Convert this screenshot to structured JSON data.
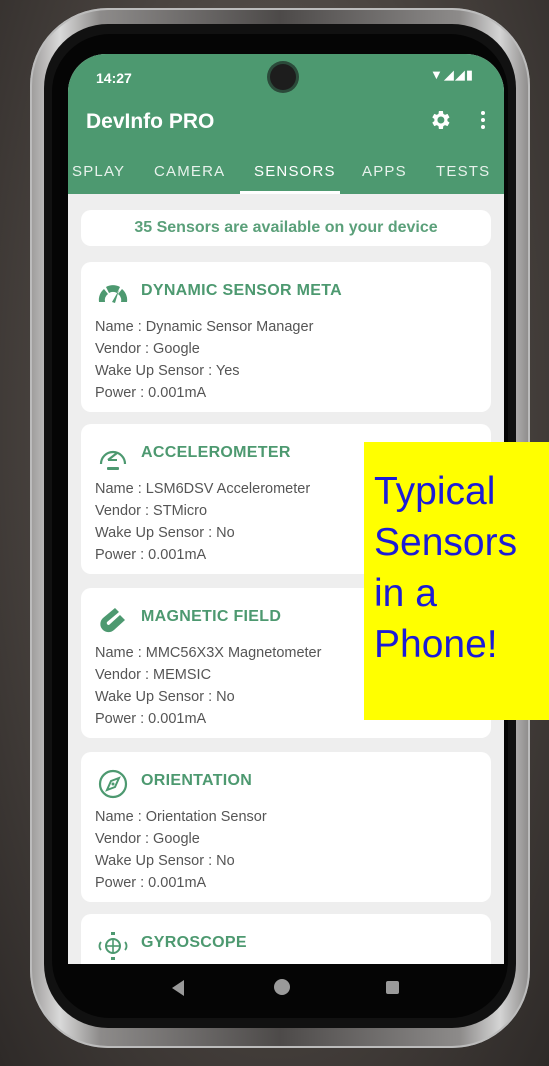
{
  "status": {
    "time": "14:27",
    "icons": "▼◢◢▮"
  },
  "app": {
    "title": "DevInfo PRO"
  },
  "tabs": [
    "SPLAY",
    "CAMERA",
    "SENSORS",
    "APPS",
    "TESTS"
  ],
  "active_tab": "SENSORS",
  "summary": "35 Sensors are available on your device",
  "sensors": [
    {
      "icon": "speedometer-icon",
      "title": "DYNAMIC SENSOR META",
      "lines": [
        "Name : Dynamic Sensor Manager",
        "Vendor : Google",
        "Wake Up Sensor : Yes",
        "Power : 0.001mA"
      ]
    },
    {
      "icon": "accelerometer-gauge-icon",
      "title": "ACCELEROMETER",
      "lines": [
        "Name : LSM6DSV Accelerometer",
        "Vendor : STMicro",
        "Wake Up Sensor : No",
        "Power : 0.001mA"
      ]
    },
    {
      "icon": "magnet-icon",
      "title": "MAGNETIC FIELD",
      "lines": [
        "Name : MMC56X3X Magnetometer",
        "Vendor : MEMSIC",
        "Wake Up Sensor : No",
        "Power : 0.001mA"
      ]
    },
    {
      "icon": "compass-icon",
      "title": "ORIENTATION",
      "lines": [
        "Name : Orientation Sensor",
        "Vendor : Google",
        "Wake Up Sensor : No",
        "Power : 0.001mA"
      ]
    },
    {
      "icon": "gyroscope-icon",
      "title": "GYROSCOPE",
      "lines": []
    }
  ],
  "callout": {
    "lines": [
      "Typical",
      "Sensors",
      "in a",
      "Phone!"
    ]
  },
  "colors": {
    "accent": "#4d9970",
    "callout_bg": "#ffff00",
    "callout_text": "#1c1cd6"
  }
}
